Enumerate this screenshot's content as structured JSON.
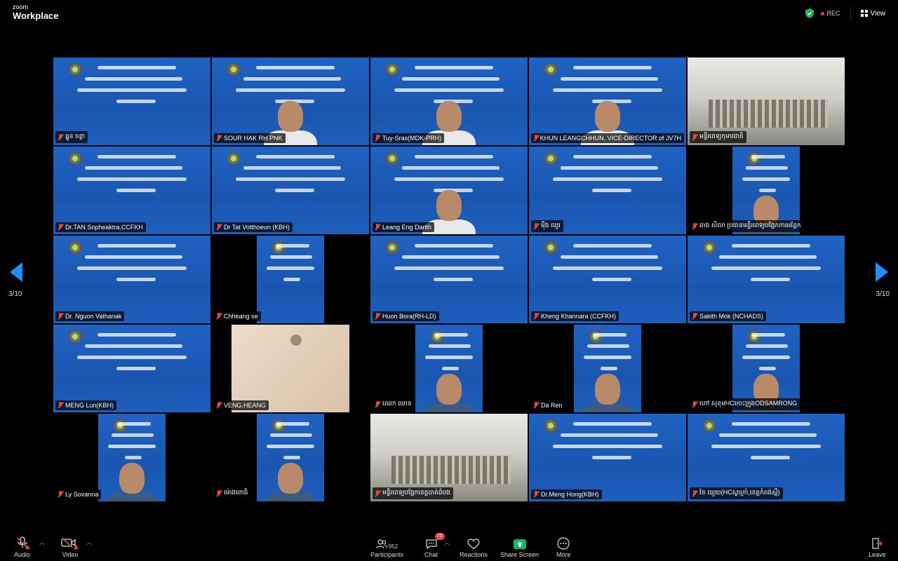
{
  "app": {
    "brand_small": "zoom",
    "brand_big": "Workplace",
    "rec_label": "REC",
    "view_label": "View"
  },
  "navigation": {
    "page_indicator": "3/10"
  },
  "participants": [
    {
      "name": "ឆ្នូន ចន្ថា",
      "kind": "slide"
    },
    {
      "name": "SOUR HAK RH PNK",
      "kind": "slide-person"
    },
    {
      "name": "Tuy-Sras(MDK-PRH)",
      "kind": "slide-person"
    },
    {
      "name": "KHUN LEANGCHHUN, VICE-DIRECTOR of JV7H",
      "kind": "slide-person"
    },
    {
      "name": "មន្ទីរពេទ្យកុមារជាតិ",
      "kind": "room"
    },
    {
      "name": "Dr.TAN Sopheaktra,CCFKH",
      "kind": "slide"
    },
    {
      "name": "Dr Tat Votthoeun (KBH)",
      "kind": "slide"
    },
    {
      "name": "Leang Eng Darith",
      "kind": "slide-person"
    },
    {
      "name": "ម៉ឹង ឈួរ",
      "kind": "slide"
    },
    {
      "name": "ឆាង សិលា ប្រធានមន្ទីរពេទ្យបង្អែកការអន្តែក",
      "kind": "narrow-person"
    },
    {
      "name": "Dr. Nguon Vathanak",
      "kind": "slide"
    },
    {
      "name": "Chheang se",
      "kind": "narrow-slide"
    },
    {
      "name": "Huon Bora(RH-LD)",
      "kind": "slide"
    },
    {
      "name": "Kheng Khannara (CCFKH)",
      "kind": "slide"
    },
    {
      "name": "Sakith Mok (NCHADS)",
      "kind": "slide"
    },
    {
      "name": "MENG Lun(KBH)",
      "kind": "slide"
    },
    {
      "name": "VENG.HEANG",
      "kind": "wall"
    },
    {
      "name": "ឈេក ឈាន",
      "kind": "narrow-person"
    },
    {
      "name": "Da Ren",
      "kind": "narrow-person"
    },
    {
      "name": "ហៅ សុខុមHCកោះក្រូងODSAMRONG",
      "kind": "narrow-person"
    },
    {
      "name": "Ly Sovanna",
      "kind": "narrow-person"
    },
    {
      "name": "ម៉ោងពោធិ",
      "kind": "narrow-person"
    },
    {
      "name": "មន្ទីរពេទ្យបង្អែកខេត្តបាត់ដំបង",
      "kind": "room"
    },
    {
      "name": "Dr.Meng Hong(KBH)",
      "kind": "slide"
    },
    {
      "name": "វ៉ន ឈួយ(HCស្លាក្រាំ,ខេត្តកំពង់ស្ពឺ)",
      "kind": "slide"
    }
  ],
  "toolbar": {
    "audio": "Audio",
    "video": "Video",
    "participants": "Participants",
    "participants_count": "952",
    "chat": "Chat",
    "chat_badge": "72",
    "reactions": "Reactions",
    "share_screen": "Share Screen",
    "more": "More",
    "leave": "Leave"
  },
  "colors": {
    "slide_blue": "#1f63c4",
    "nav_arrow": "#1e90ff",
    "muted_red": "#e8473b",
    "share_green": "#12b76a"
  }
}
